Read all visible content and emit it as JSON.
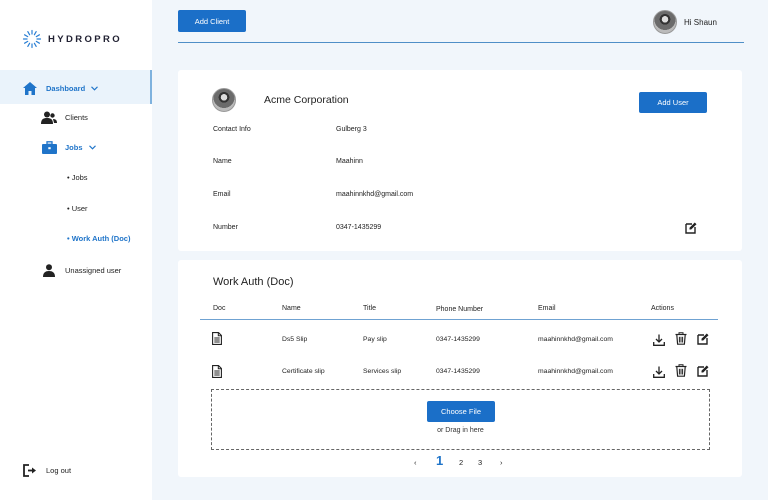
{
  "brand": {
    "name": "HYDROPRO"
  },
  "sidebar": {
    "items": [
      {
        "label": "Dashboard",
        "icon": "home-icon"
      },
      {
        "label": "Clients",
        "icon": "users-icon"
      },
      {
        "label": "Jobs",
        "icon": "briefcase-icon"
      },
      {
        "label": "Unassigned user",
        "icon": "user-icon"
      }
    ],
    "jobs_sub": [
      {
        "label": "Jobs"
      },
      {
        "label": "User"
      },
      {
        "label": "Work Auth (Doc)"
      }
    ],
    "logout": "Log out",
    "active_sub": "Work Auth (Doc)"
  },
  "header": {
    "add_client": "Add Client",
    "greeting": "Hi Shaun"
  },
  "client": {
    "name": "Acme Corporation",
    "add_user": "Add User",
    "fields": [
      {
        "label": "Contact Info",
        "value": "Gulberg 3"
      },
      {
        "label": "Name",
        "value": "Maahinn"
      },
      {
        "label": "Email",
        "value": "maahinnkhd@gmail.com"
      },
      {
        "label": "Number",
        "value": "0347-1435299"
      }
    ]
  },
  "docs": {
    "title": "Work Auth (Doc)",
    "columns": [
      "Doc",
      "Name",
      "Title",
      "Phone Number",
      "Email",
      "Actions"
    ],
    "rows": [
      {
        "name": "Ds5 Slip",
        "title": "Pay slip",
        "phone": "0347-1435299",
        "email": "maahinnkhd@gmail.com"
      },
      {
        "name": "Certificate slip",
        "title": "Services slip",
        "phone": "0347-1435299",
        "email": "maahinnkhd@gmail.com"
      }
    ],
    "choose_file": "Choose File",
    "drag_text": "or Drag in here"
  },
  "pagination": {
    "prev": "‹",
    "pages": [
      "1",
      "2",
      "3"
    ],
    "next": "›",
    "current": "1"
  },
  "colors": {
    "primary": "#1b6fc8",
    "active_text": "#1f74c9",
    "background": "#f1f6fb"
  }
}
